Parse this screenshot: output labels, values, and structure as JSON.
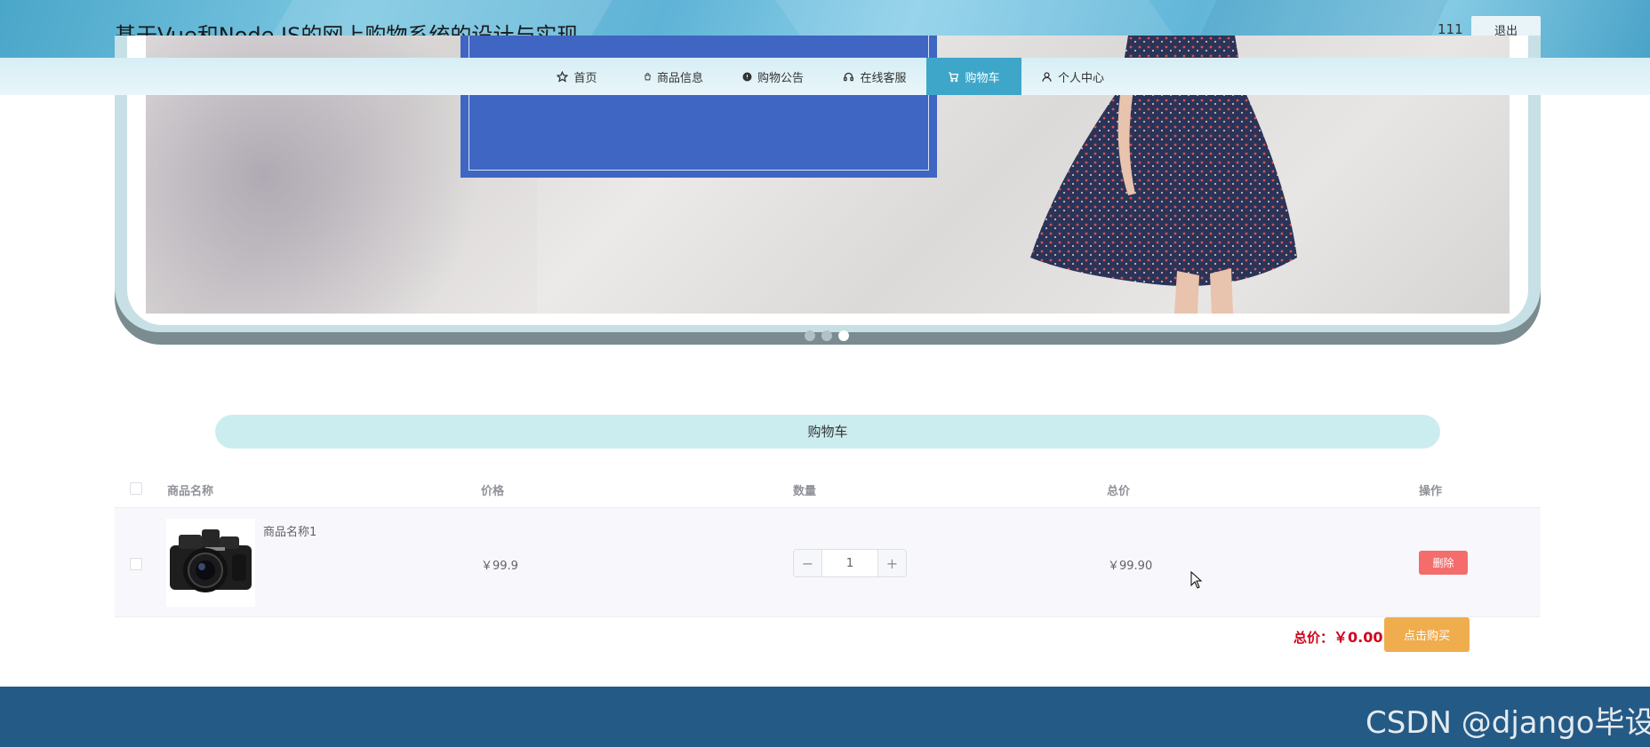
{
  "header": {
    "site_title": "基于Vue和Node JS的网上购物系统的设计与实现",
    "username": "111",
    "logout_label": "退出"
  },
  "nav": {
    "items": [
      {
        "label": "首页",
        "icon": "star-icon",
        "active": false
      },
      {
        "label": "商品信息",
        "icon": "bag-icon",
        "active": false
      },
      {
        "label": "购物公告",
        "icon": "info-circle-icon",
        "active": false
      },
      {
        "label": "在线客服",
        "icon": "headset-icon",
        "active": false
      },
      {
        "label": "购物车",
        "icon": "cart-icon",
        "active": true
      },
      {
        "label": "个人中心",
        "icon": "user-icon",
        "active": false
      }
    ]
  },
  "banner": {
    "slide_count": 3,
    "active_slide_index": 2
  },
  "cart": {
    "section_title": "购物车",
    "columns": [
      "商品名称",
      "价格",
      "数量",
      "总价",
      "操作"
    ],
    "rows": [
      {
        "name": "商品名称1",
        "price": "￥99.9",
        "quantity": "1",
        "total": "￥99.90",
        "delete_label": "删除",
        "image": "camera-product-image"
      }
    ],
    "stepper_minus": "−",
    "stepper_plus": "+",
    "grand_total_label": "总价：",
    "grand_total_value": "￥0.00",
    "buy_label": "点击购买"
  },
  "colors": {
    "nav_active": "#3ea7c9",
    "delete_button": "#f56c6c",
    "buy_button": "#f0ad4e",
    "total_text": "#d0021b",
    "footer": "#245a86",
    "section_title_bg": "#ccedf0"
  },
  "watermark": "CSDN @django毕设"
}
